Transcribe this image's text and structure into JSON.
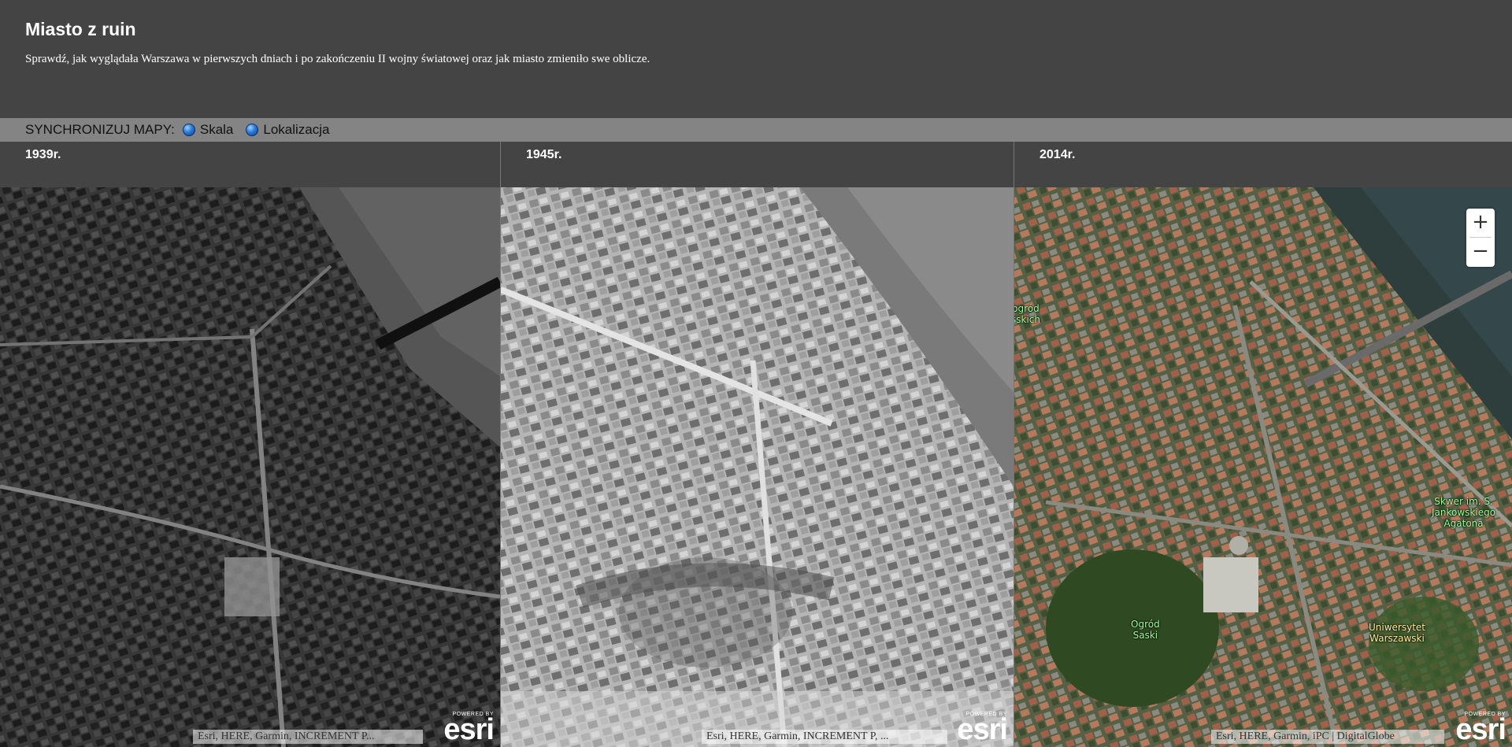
{
  "header": {
    "title": "Miasto z ruin",
    "subtitle": "Sprawdź, jak wyglądała Warszawa w pierwszych dniach i po zakończeniu II wojny światowej oraz jak miasto zmieniło swe oblicze."
  },
  "sync": {
    "label": "SYNCHRONIZUJ MAPY:",
    "options": [
      "Skala",
      "Lokalizacja"
    ]
  },
  "panels": [
    {
      "year": "1939r.",
      "attribution": "Esri, HERE, Garmin, INCREMENT P..."
    },
    {
      "year": "1945r.",
      "attribution": "Esri, HERE, Garmin, INCREMENT P, ..."
    },
    {
      "year": "2014r.",
      "attribution": "Esri, HERE, Garmin, iPC | DigitalGlobe"
    }
  ],
  "esri": {
    "powered": "POWERED BY",
    "logo": "esri"
  },
  "zoom": {
    "plus": "+",
    "minus": "−"
  },
  "map_labels": {
    "ogrod_left": "ogród\nsskich",
    "skwer": "Skwer im. S.\nJankowskiego\nAgatona",
    "ogrod_saski": "Ogród\nSaski",
    "uniwersytet": "Uniwersytet\nWarszawski"
  },
  "colors": {
    "header_bg": "#444444",
    "syncbar_bg": "#848484",
    "radio": "#2a7bd8"
  }
}
